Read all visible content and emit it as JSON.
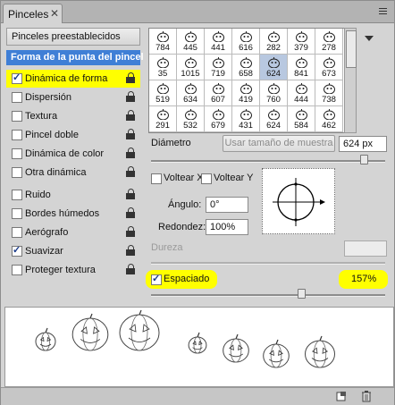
{
  "tab": {
    "title": "Pinceles",
    "close_glyph": "✕"
  },
  "left_panel": {
    "presets_label": "Pinceles preestablecidos",
    "tip_shape_label": "Forma de la punta del pincel",
    "options": [
      {
        "label": "Dinámica de forma",
        "checked": true,
        "highlighted": true,
        "lock": true
      },
      {
        "label": "Dispersión",
        "checked": false,
        "highlighted": false,
        "lock": true
      },
      {
        "label": "Textura",
        "checked": false,
        "highlighted": false,
        "lock": true
      },
      {
        "label": "Pincel doble",
        "checked": false,
        "highlighted": false,
        "lock": true
      },
      {
        "label": "Dinámica de color",
        "checked": false,
        "highlighted": false,
        "lock": true
      },
      {
        "label": "Otra dinámica",
        "checked": false,
        "highlighted": false,
        "lock": true
      },
      {
        "label": "Ruido",
        "checked": false,
        "highlighted": false,
        "lock": true
      },
      {
        "label": "Bordes húmedos",
        "checked": false,
        "highlighted": false,
        "lock": true
      },
      {
        "label": "Aerógrafo",
        "checked": false,
        "highlighted": false,
        "lock": true
      },
      {
        "label": "Suavizar",
        "checked": true,
        "highlighted": false,
        "lock": true
      },
      {
        "label": "Proteger textura",
        "checked": false,
        "highlighted": false,
        "lock": true
      }
    ]
  },
  "brush_grid": {
    "rows": [
      [
        {
          "num": "784"
        },
        {
          "num": "445"
        },
        {
          "num": "441"
        },
        {
          "num": "616"
        },
        {
          "num": "282"
        },
        {
          "num": "379"
        },
        {
          "num": "278"
        }
      ],
      [
        {
          "num": "35"
        },
        {
          "num": "1015"
        },
        {
          "num": "719"
        },
        {
          "num": "658"
        },
        {
          "num": "624",
          "selected": true
        },
        {
          "num": "841"
        },
        {
          "num": "673"
        }
      ],
      [
        {
          "num": "519"
        },
        {
          "num": "634"
        },
        {
          "num": "607"
        },
        {
          "num": "419"
        },
        {
          "num": "760"
        },
        {
          "num": "444"
        },
        {
          "num": "738"
        }
      ],
      [
        {
          "num": "291"
        },
        {
          "num": "532"
        },
        {
          "num": "679"
        },
        {
          "num": "431"
        },
        {
          "num": "624"
        },
        {
          "num": "584"
        },
        {
          "num": "462"
        }
      ]
    ]
  },
  "diameter": {
    "label": "Diámetro",
    "sample_button": "Usar tamaño de muestra",
    "value": "624 px"
  },
  "flip": {
    "x_label": "Voltear X",
    "y_label": "Voltear Y"
  },
  "angle": {
    "label": "Ángulo:",
    "value": "0°"
  },
  "roundness": {
    "label": "Redondez:",
    "value": "100%"
  },
  "hardness": {
    "label": "Dureza"
  },
  "spacing": {
    "label": "Espaciado",
    "checked": true,
    "value": "157%"
  },
  "colors": {
    "highlight": "#ffff00",
    "selection": "#3f7fd6"
  },
  "icons": [
    "menu-icon",
    "lock-icon",
    "new-brush-icon",
    "trash-icon",
    "pumpkin-icon"
  ]
}
